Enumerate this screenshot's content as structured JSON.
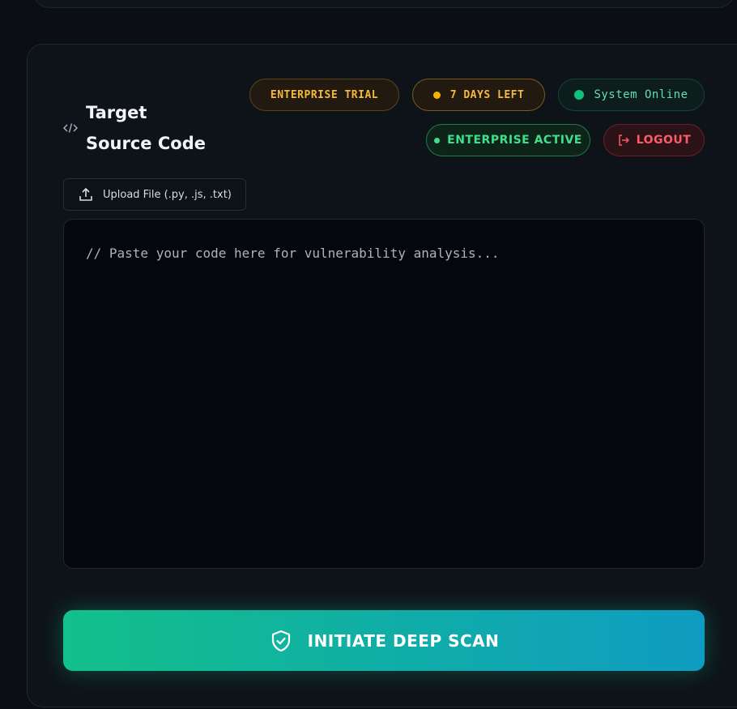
{
  "header": {
    "title_line1": "Target",
    "title_line2": "Source Code",
    "icons": {
      "code": "code-icon"
    }
  },
  "badges": {
    "trial": "ENTERPRISE TRIAL",
    "days_left": "7 DAYS LEFT",
    "status": "System Online",
    "plan": "ENTERPRISE ACTIVE",
    "logout": "LOGOUT"
  },
  "upload": {
    "label": "Upload File (.py, .js, .txt)",
    "icon": "upload-icon"
  },
  "editor": {
    "placeholder": "// Paste your code here for vulnerability analysis...",
    "value": ""
  },
  "scan": {
    "label": "INITIATE DEEP SCAN",
    "icon": "shield-check-icon"
  },
  "colors": {
    "accent_green": "#12c08a",
    "accent_blue": "#0f9cc2",
    "warning": "#f5b93a",
    "danger": "#ff5b66"
  }
}
